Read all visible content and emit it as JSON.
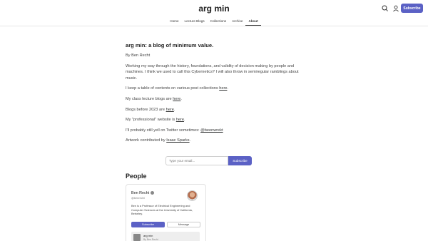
{
  "header": {
    "site_title": "arg min",
    "subscribe_label": "Subscribe",
    "icons": [
      "search-icon",
      "user-icon"
    ]
  },
  "nav": {
    "items": [
      {
        "label": "Home",
        "active": false
      },
      {
        "label": "Lecture Blogs",
        "active": false
      },
      {
        "label": "Collections",
        "active": false
      },
      {
        "label": "Archive",
        "active": false
      },
      {
        "label": "About",
        "active": true
      }
    ]
  },
  "about": {
    "title": "arg min: a blog of minimum value.",
    "byline": "By Ben Recht",
    "p1": "Working my way through the history, foundations, and validity of decision making by people and machines. I think we used to call this Cybernetics? I will also throw in semiregular ramblings about music.",
    "p2_pre": "I keep a table of contents on various post collections ",
    "p2_link": "here",
    "p2_post": ".",
    "p3_pre": "My class lecture blogs are ",
    "p3_link": "here",
    "p3_post": ".",
    "p4_pre": "Blogs before 2023 are ",
    "p4_link": "here",
    "p4_post": ".",
    "p5_pre": "My \"professional\" website is ",
    "p5_link": "here",
    "p5_post": ".",
    "p6_pre": "I'll probably still yell on Twitter sometimes: ",
    "p6_link": "@beenwrekt",
    "p7_pre": "Artwork contributed by ",
    "p7_link": "Isaac Sparks",
    "p7_post": "."
  },
  "subscribe_form": {
    "email_placeholder": "Type your email...",
    "button_label": "Subscribe"
  },
  "people": {
    "heading": "People",
    "card": {
      "name": "Ben Recht",
      "handle": "@benrecht",
      "bio": "Ben is a Professor of Electrical Engineering and Computer Sciences at the University of California, Berkeley.",
      "subscribe_label": "Subscribe",
      "message_label": "Message",
      "publication_name": "arg min",
      "publication_author": "By Ben Recht"
    }
  },
  "colors": {
    "accent": "#5b61c5",
    "text": "#363737"
  }
}
